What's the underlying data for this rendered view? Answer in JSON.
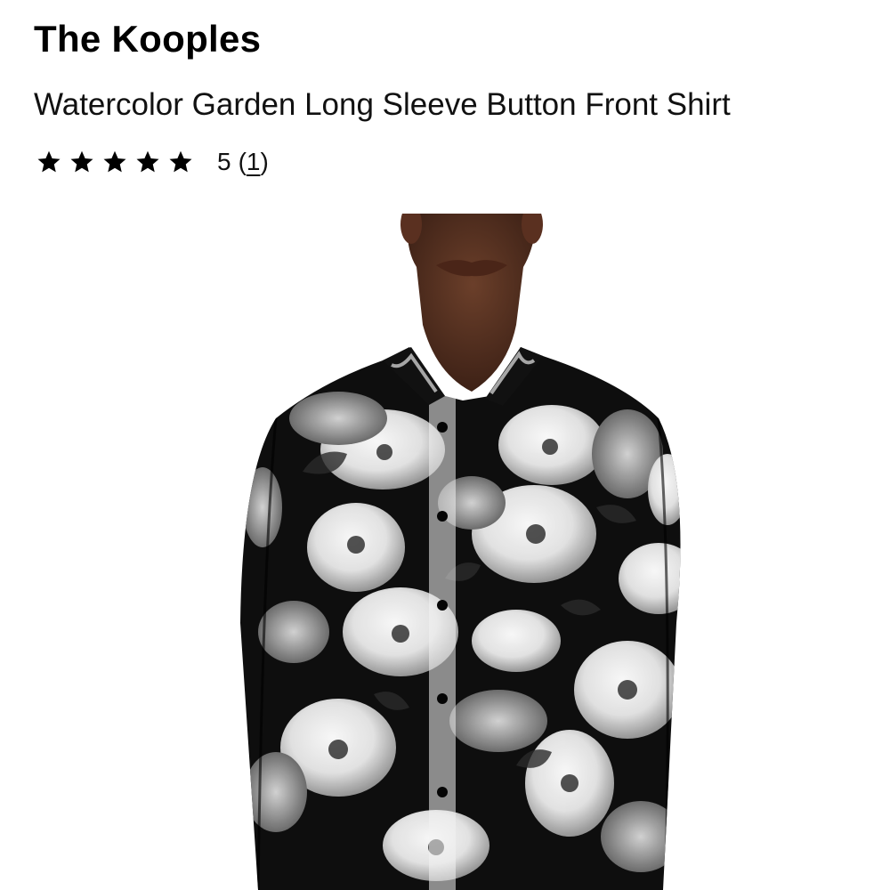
{
  "product": {
    "brand": "The Kooples",
    "title": "Watercolor Garden Long Sleeve Button Front Shirt",
    "rating": {
      "stars": 5,
      "max_stars": 5,
      "value_label": "5",
      "open_paren": "(",
      "review_count": "1",
      "close_paren": ")"
    },
    "image": {
      "alt": "Watercolor Garden Long Sleeve Button Front Shirt"
    }
  },
  "colors": {
    "text": "#000000",
    "background": "#ffffff",
    "star": "#000000"
  },
  "icons": {
    "rating_star": "star-icon"
  }
}
